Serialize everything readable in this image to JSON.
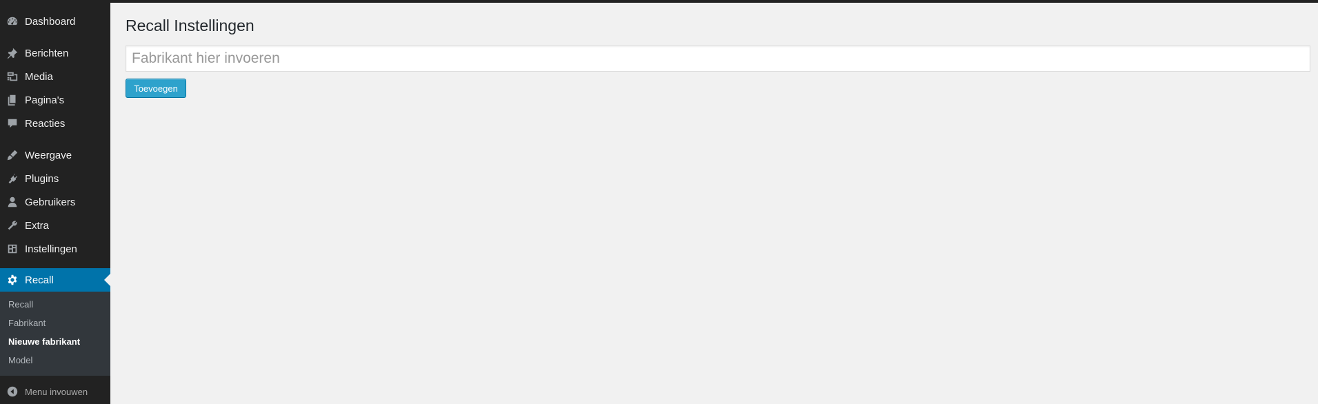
{
  "sidebar": {
    "items": [
      {
        "label": "Dashboard",
        "icon": "dashboard-icon"
      },
      {
        "label": "Berichten",
        "icon": "pushpin-icon"
      },
      {
        "label": "Media",
        "icon": "media-icon"
      },
      {
        "label": "Pagina's",
        "icon": "pages-icon"
      },
      {
        "label": "Reacties",
        "icon": "comment-icon"
      },
      {
        "label": "Weergave",
        "icon": "brush-icon"
      },
      {
        "label": "Plugins",
        "icon": "plug-icon"
      },
      {
        "label": "Gebruikers",
        "icon": "user-icon"
      },
      {
        "label": "Extra",
        "icon": "wrench-icon"
      },
      {
        "label": "Instellingen",
        "icon": "settings-icon"
      },
      {
        "label": "Recall",
        "icon": "gear-icon"
      }
    ],
    "submenu": [
      {
        "label": "Recall"
      },
      {
        "label": "Fabrikant"
      },
      {
        "label": "Nieuwe fabrikant"
      },
      {
        "label": "Model"
      }
    ],
    "collapse_label": "Menu invouwen"
  },
  "main": {
    "title": "Recall Instellingen",
    "input_placeholder": "Fabrikant hier invoeren",
    "input_value": "",
    "add_button_label": "Toevoegen"
  },
  "colors": {
    "sidebar_bg": "#222222",
    "accent": "#0073aa",
    "button": "#2ea2cc",
    "content_bg": "#f1f1f1"
  }
}
